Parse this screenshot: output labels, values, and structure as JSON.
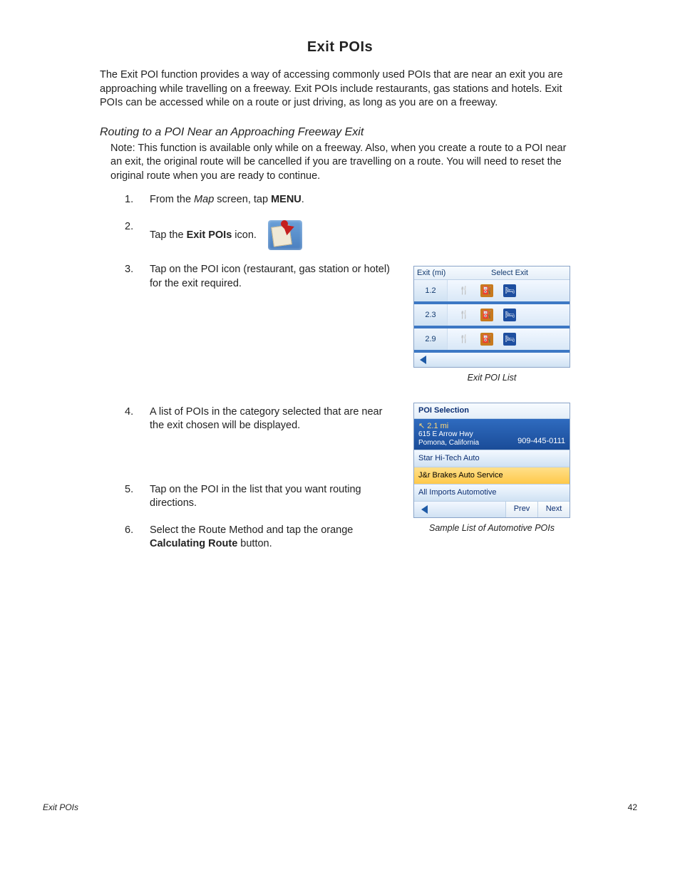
{
  "title": "Exit POIs",
  "intro": "The Exit POI function provides a way of accessing commonly used POIs that are near an exit you are approaching while travelling on a freeway.  Exit POIs include restaurants, gas stations and hotels.  Exit POIs can be accessed while on a route or just driving, as long as you are on a freeway.",
  "subhead": "Routing to a POI Near an Approaching Freeway Exit",
  "note": "Note: This function is available only while on a freeway.  Also, when you create a route to a POI near an exit, the original route will be cancelled if you are travelling on a route.  You will need to reset the original route when you are ready to continue.",
  "steps": {
    "s1a": "From the ",
    "s1b": "Map",
    "s1c": " screen, tap ",
    "s1d": "MENU",
    "s1e": ".",
    "s2a": "Tap the ",
    "s2b": "Exit POIs",
    "s2c": " icon.",
    "s3": "Tap on the POI icon (restaurant, gas station or hotel) for the exit required.",
    "s4": "A list of POIs in the category selected that are near the exit chosen will be displayed.",
    "s5": "Tap on the POI in the list that you want routing directions.",
    "s6a": "Select the Route Method and tap the orange ",
    "s6b": "Calculating Route",
    "s6c": " button."
  },
  "fig1": {
    "header_left": "Exit (mi)",
    "header_right": "Select Exit",
    "rows": [
      {
        "dist": "1.2"
      },
      {
        "dist": "2.3"
      },
      {
        "dist": "2.9"
      }
    ],
    "caption": "Exit POI List"
  },
  "fig2": {
    "title": "POI Selection",
    "dist": "2.1 mi",
    "addr1": "615 E Arrow Hwy",
    "addr2": "Pomona, California",
    "phone": "909-445-0111",
    "items": [
      {
        "name": "Star Hi-Tech Auto",
        "selected": false
      },
      {
        "name": "J&r Brakes Auto Service",
        "selected": true
      },
      {
        "name": "All Imports Automotive",
        "selected": false
      }
    ],
    "prev": "Prev",
    "next": "Next",
    "caption": "Sample List of Automotive POIs"
  },
  "footer": {
    "left": "Exit POIs",
    "right": "42"
  }
}
